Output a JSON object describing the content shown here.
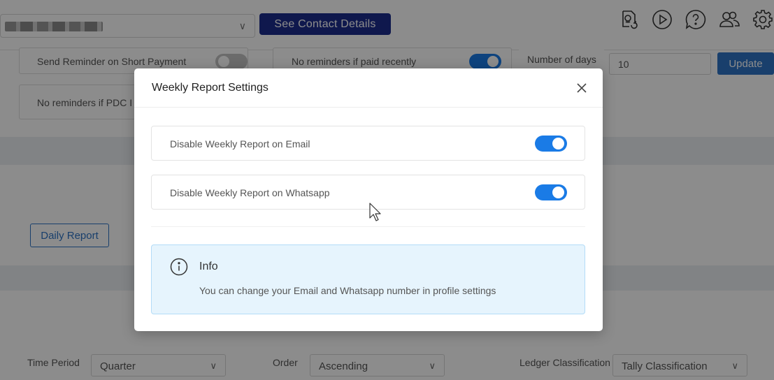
{
  "header": {
    "company_select_chevron": "∨",
    "contact_button": "See Contact Details",
    "icons": [
      "report-sync-icon",
      "play-icon",
      "help-icon",
      "users-icon",
      "gear-icon"
    ]
  },
  "reminders": {
    "short_payment_label": "Send Reminder on Short Payment",
    "paid_recently_label": "No reminders if paid recently",
    "number_of_days_label": "Number of days",
    "number_of_days_value": "10",
    "update_button": "Update",
    "pdc_label": "No reminders if PDC I"
  },
  "reports": {
    "daily_report_button": "Daily Report"
  },
  "filters": {
    "time_period_label": "Time Period",
    "time_period_value": "Quarter",
    "order_label": "Order",
    "order_value": "Ascending",
    "ledger_label": "Ledger Classification",
    "ledger_value": "Tally Classification",
    "chevron": "∨"
  },
  "modal": {
    "title": "Weekly Report Settings",
    "close_icon": "close-icon",
    "settings": [
      {
        "label": "Disable Weekly Report on Email",
        "enabled": true
      },
      {
        "label": "Disable Weekly Report on Whatsapp",
        "enabled": true
      }
    ],
    "info": {
      "title": "Info",
      "text": "You can change your Email and Whatsapp number in profile settings"
    }
  },
  "colors": {
    "primary": "#1c2d8c",
    "toggle_on": "#1a7be6",
    "info_bg": "#e6f4fd",
    "update_button": "#2e74c5"
  }
}
